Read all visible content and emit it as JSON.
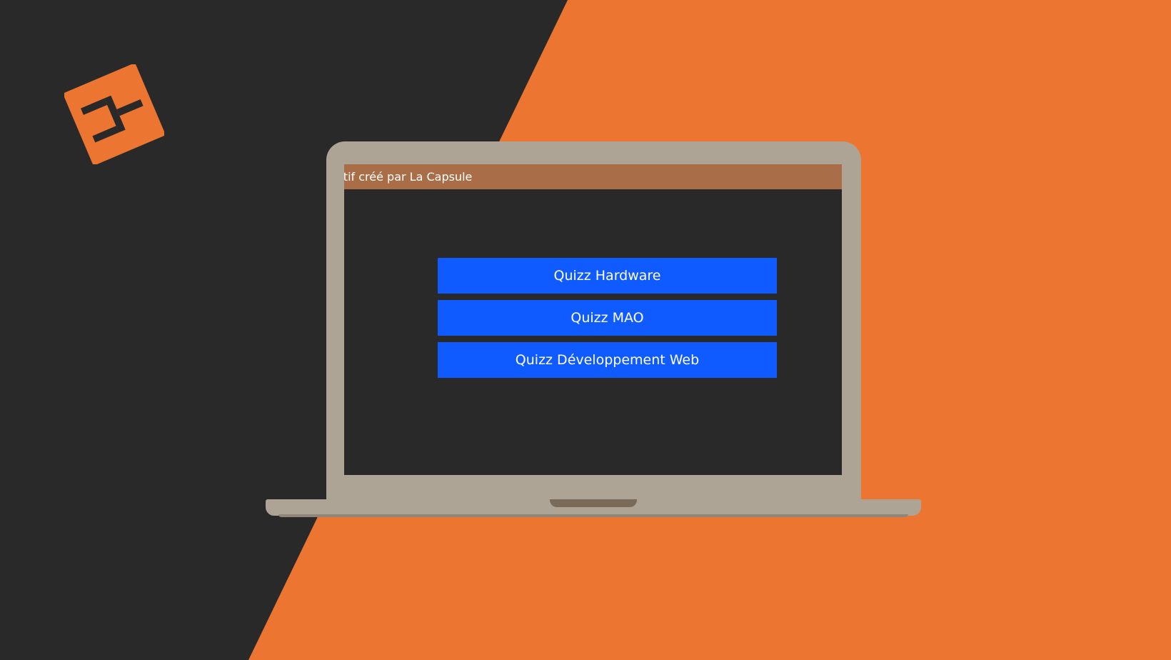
{
  "background": {
    "dark_color": "#292929",
    "accent_color": "#ed7532"
  },
  "logo": {
    "icon": "brand-logo-icon",
    "color": "#ed7532"
  },
  "laptop": {
    "frame_color": "#aea496",
    "screen": {
      "background": "#292929",
      "topbar": {
        "text": "ctif créé par La Capsule",
        "background": "#a96e48"
      },
      "quiz_buttons": [
        {
          "label": "Quizz Hardware"
        },
        {
          "label": "Quizz MAO"
        },
        {
          "label": "Quizz Développement Web"
        }
      ],
      "button_color": "#0f5bff"
    }
  }
}
